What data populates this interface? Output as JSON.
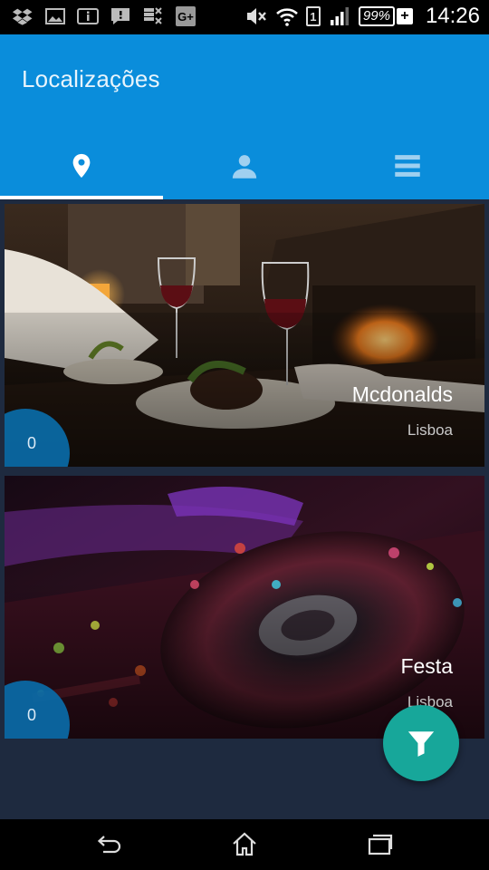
{
  "status_bar": {
    "left_icons": [
      "dropbox-icon",
      "image-icon",
      "info-icon",
      "chat-icon",
      "usb-icon",
      "google-plus-icon"
    ],
    "sim": "1",
    "battery": "99%",
    "time": "14:26"
  },
  "app_bar": {
    "title": "Localizações",
    "tabs": [
      {
        "icon": "location-pin-icon",
        "selected": true
      },
      {
        "icon": "person-icon",
        "selected": false
      },
      {
        "icon": "menu-icon",
        "selected": false
      }
    ],
    "color": "#0a8ddb"
  },
  "locations": [
    {
      "name": "Mcdonalds",
      "city": "Lisboa",
      "count": "0",
      "photo": "restaurant-dinner"
    },
    {
      "name": "Festa",
      "city": "Lisboa",
      "count": "0",
      "photo": "dj-turntable"
    }
  ],
  "fab": {
    "icon": "filter-icon",
    "color": "#17a79a"
  },
  "nav_bar": {
    "buttons": [
      "back-icon",
      "home-icon",
      "recent-apps-icon"
    ]
  }
}
